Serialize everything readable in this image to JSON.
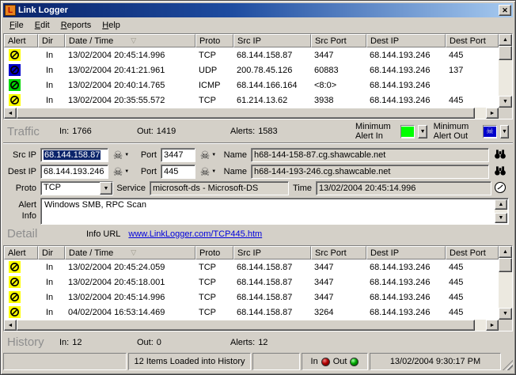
{
  "window": {
    "title": "Link Logger",
    "app_icon_letter": "L"
  },
  "menu": {
    "items": [
      "File",
      "Edit",
      "Reports",
      "Help"
    ]
  },
  "glyphs": {
    "up": "▲",
    "down": "▼",
    "left": "◄",
    "right": "►",
    "dropdown": "▼",
    "skull": "☠",
    "sort": "▽",
    "close": "✕"
  },
  "table": {
    "columns": [
      "Alert",
      "Dir",
      "Date / Time",
      "Proto",
      "Src IP",
      "Src Port",
      "Dest IP",
      "Dest Port"
    ]
  },
  "traffic": {
    "rows": [
      {
        "alert_color": "#ffff00",
        "dir": "In",
        "datetime": "13/02/2004 20:45:14.996",
        "proto": "TCP",
        "src_ip": "68.144.158.87",
        "src_port": "3447",
        "dest_ip": "68.144.193.246",
        "dest_port": "445"
      },
      {
        "alert_color": "#0000cc",
        "dir": "In",
        "datetime": "13/02/2004 20:41:21.961",
        "proto": "UDP",
        "src_ip": "200.78.45.126",
        "src_port": "60883",
        "dest_ip": "68.144.193.246",
        "dest_port": "137"
      },
      {
        "alert_color": "#00d800",
        "dir": "In",
        "datetime": "13/02/2004 20:40:14.765",
        "proto": "ICMP",
        "src_ip": "68.144.166.164",
        "src_port": "<8:0>",
        "dest_ip": "68.144.193.246",
        "dest_port": ""
      },
      {
        "alert_color": "#ffff00",
        "dir": "In",
        "datetime": "13/02/2004 20:35:55.572",
        "proto": "TCP",
        "src_ip": "61.214.13.62",
        "src_port": "3938",
        "dest_ip": "68.144.193.246",
        "dest_port": "445"
      }
    ],
    "summary": {
      "label": "Traffic",
      "in_label": "In:",
      "in_value": "1766",
      "out_label": "Out:",
      "out_value": "1419",
      "alerts_label": "Alerts:",
      "alerts_value": "1583",
      "min_in_label": "Minimum Alert In",
      "min_out_label": "Minimum Alert Out",
      "min_in_color": "#00ff00",
      "min_out_color": "#0000cc"
    }
  },
  "detail": {
    "src_ip_label": "Src IP",
    "src_ip": "68.144.158.87",
    "src_port_label": "Port",
    "src_port": "3447",
    "src_name_label": "Name",
    "src_name": "h68-144-158-87.cg.shawcable.net",
    "dest_ip_label": "Dest IP",
    "dest_ip": "68.144.193.246",
    "dest_port_label": "Port",
    "dest_port": "445",
    "dest_name_label": "Name",
    "dest_name": "h68-144-193-246.cg.shawcable.net",
    "proto_label": "Proto",
    "proto": "TCP",
    "service_label": "Service",
    "service": "microsoft-ds - Microsoft-DS",
    "time_label": "Time",
    "time": "13/02/2004 20:45:14.996",
    "alert_info_label": "Alert Info",
    "alert_info": "Windows SMB, RPC Scan",
    "section_label": "Detail",
    "info_url_label": "Info URL",
    "info_url": "www.LinkLogger.com/TCP445.htm"
  },
  "history": {
    "rows": [
      {
        "alert_color": "#ffff00",
        "dir": "In",
        "datetime": "13/02/2004 20:45:24.059",
        "proto": "TCP",
        "src_ip": "68.144.158.87",
        "src_port": "3447",
        "dest_ip": "68.144.193.246",
        "dest_port": "445"
      },
      {
        "alert_color": "#ffff00",
        "dir": "In",
        "datetime": "13/02/2004 20:45:18.001",
        "proto": "TCP",
        "src_ip": "68.144.158.87",
        "src_port": "3447",
        "dest_ip": "68.144.193.246",
        "dest_port": "445"
      },
      {
        "alert_color": "#ffff00",
        "dir": "In",
        "datetime": "13/02/2004 20:45:14.996",
        "proto": "TCP",
        "src_ip": "68.144.158.87",
        "src_port": "3447",
        "dest_ip": "68.144.193.246",
        "dest_port": "445"
      },
      {
        "alert_color": "#ffff00",
        "dir": "In",
        "datetime": "04/02/2004 16:53:14.469",
        "proto": "TCP",
        "src_ip": "68.144.158.87",
        "src_port": "3264",
        "dest_ip": "68.144.193.246",
        "dest_port": "445"
      }
    ],
    "summary": {
      "label": "History",
      "in_label": "In:",
      "in_value": "12",
      "out_label": "Out:",
      "out_value": "0",
      "alerts_label": "Alerts:",
      "alerts_value": "12"
    }
  },
  "status": {
    "message": "12 Items Loaded into History",
    "in_label": "In",
    "out_label": "Out",
    "in_color": "#b00000",
    "out_color": "#00a800",
    "timestamp": "13/02/2004 9:30:17 PM"
  },
  "colors": {
    "chrome": "#d4d0c8",
    "title_gradient_start": "#0a246a",
    "title_gradient_end": "#a6caf0",
    "link": "#0000dd"
  }
}
